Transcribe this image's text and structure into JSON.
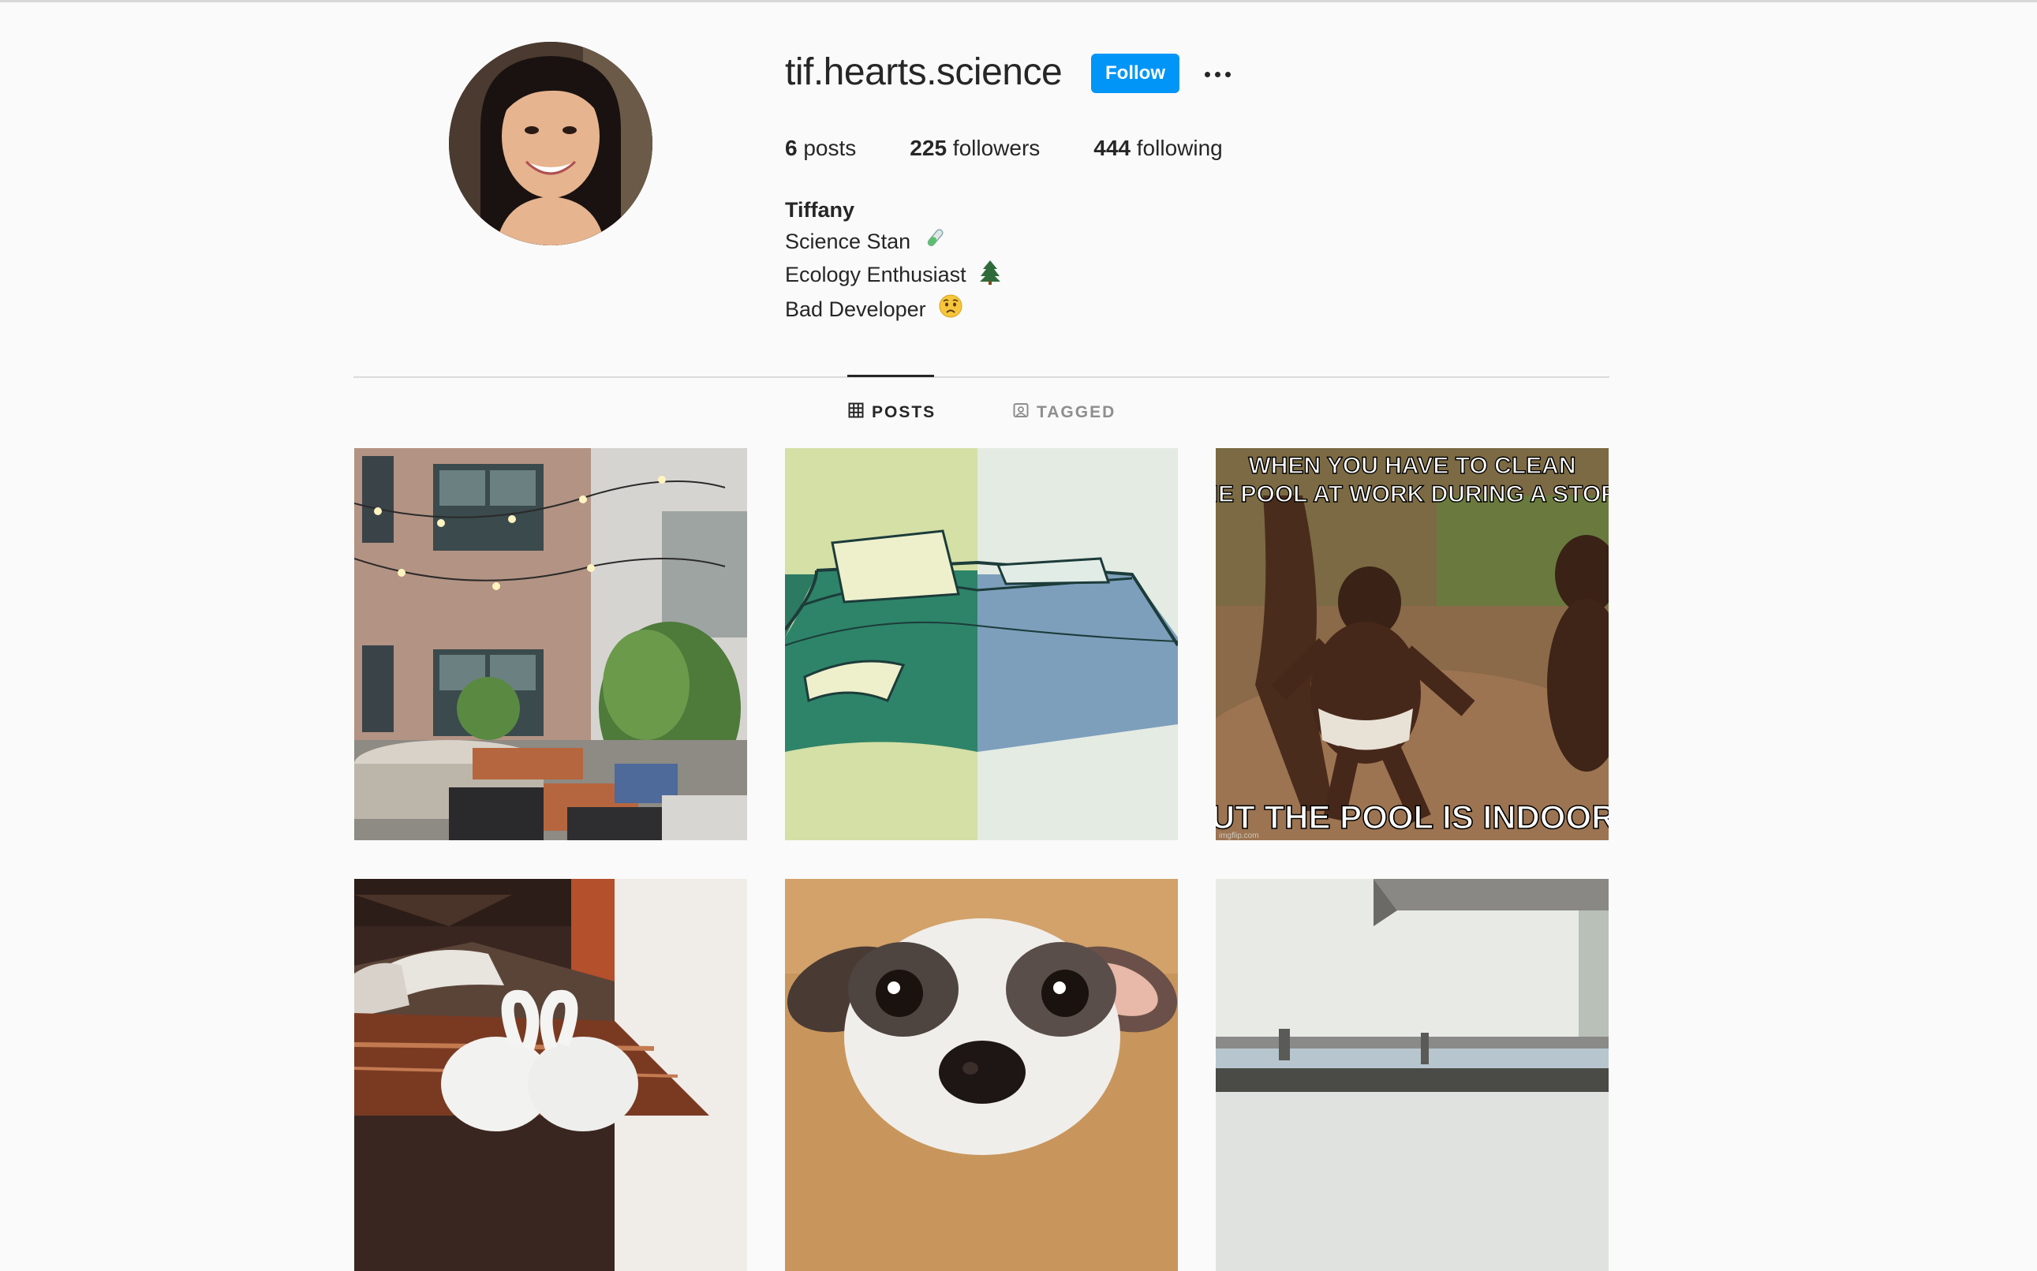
{
  "profile": {
    "username": "tif.hearts.science",
    "follow_label": "Follow",
    "more_icon": "more-horizontal-icon",
    "stats": {
      "posts_count": "6",
      "posts_label": "posts",
      "followers_count": "225",
      "followers_label": "followers",
      "following_count": "444",
      "following_label": "following"
    },
    "bio": {
      "name": "Tiffany",
      "lines": [
        {
          "text": "Science Stan",
          "emoji": "test-tube-icon"
        },
        {
          "text": "Ecology Enthusiast",
          "emoji": "evergreen-tree-icon"
        },
        {
          "text": "Bad Developer",
          "emoji": "worried-face-icon"
        }
      ]
    }
  },
  "tabs": [
    {
      "label": "POSTS",
      "icon": "grid-icon",
      "active": true
    },
    {
      "label": "TAGGED",
      "icon": "tagged-person-icon",
      "active": false
    }
  ],
  "posts": [
    {
      "description_icon": "courtyard-photo"
    },
    {
      "description_icon": "bed-illustration"
    },
    {
      "meme_top": "WHEN YOU HAVE TO CLEAN THE POOL AT WORK DURING A  STORM",
      "meme_top_line1": "WHEN YOU HAVE TO CLEAN",
      "meme_top_line2": "THE POOL AT WORK DURING A  STORM",
      "meme_bottom": "BUT THE POOL IS INDOORS",
      "watermark": "imgflip.com"
    },
    {
      "description_icon": "hotel-bed-swans-photo"
    },
    {
      "description_icon": "dog-closeup-photo"
    },
    {
      "description_icon": "harbor-balcony-photo"
    }
  ],
  "colors": {
    "accent": "#0095f6",
    "background": "#fafafa",
    "text": "#262626",
    "muted": "#8e8e8e"
  }
}
